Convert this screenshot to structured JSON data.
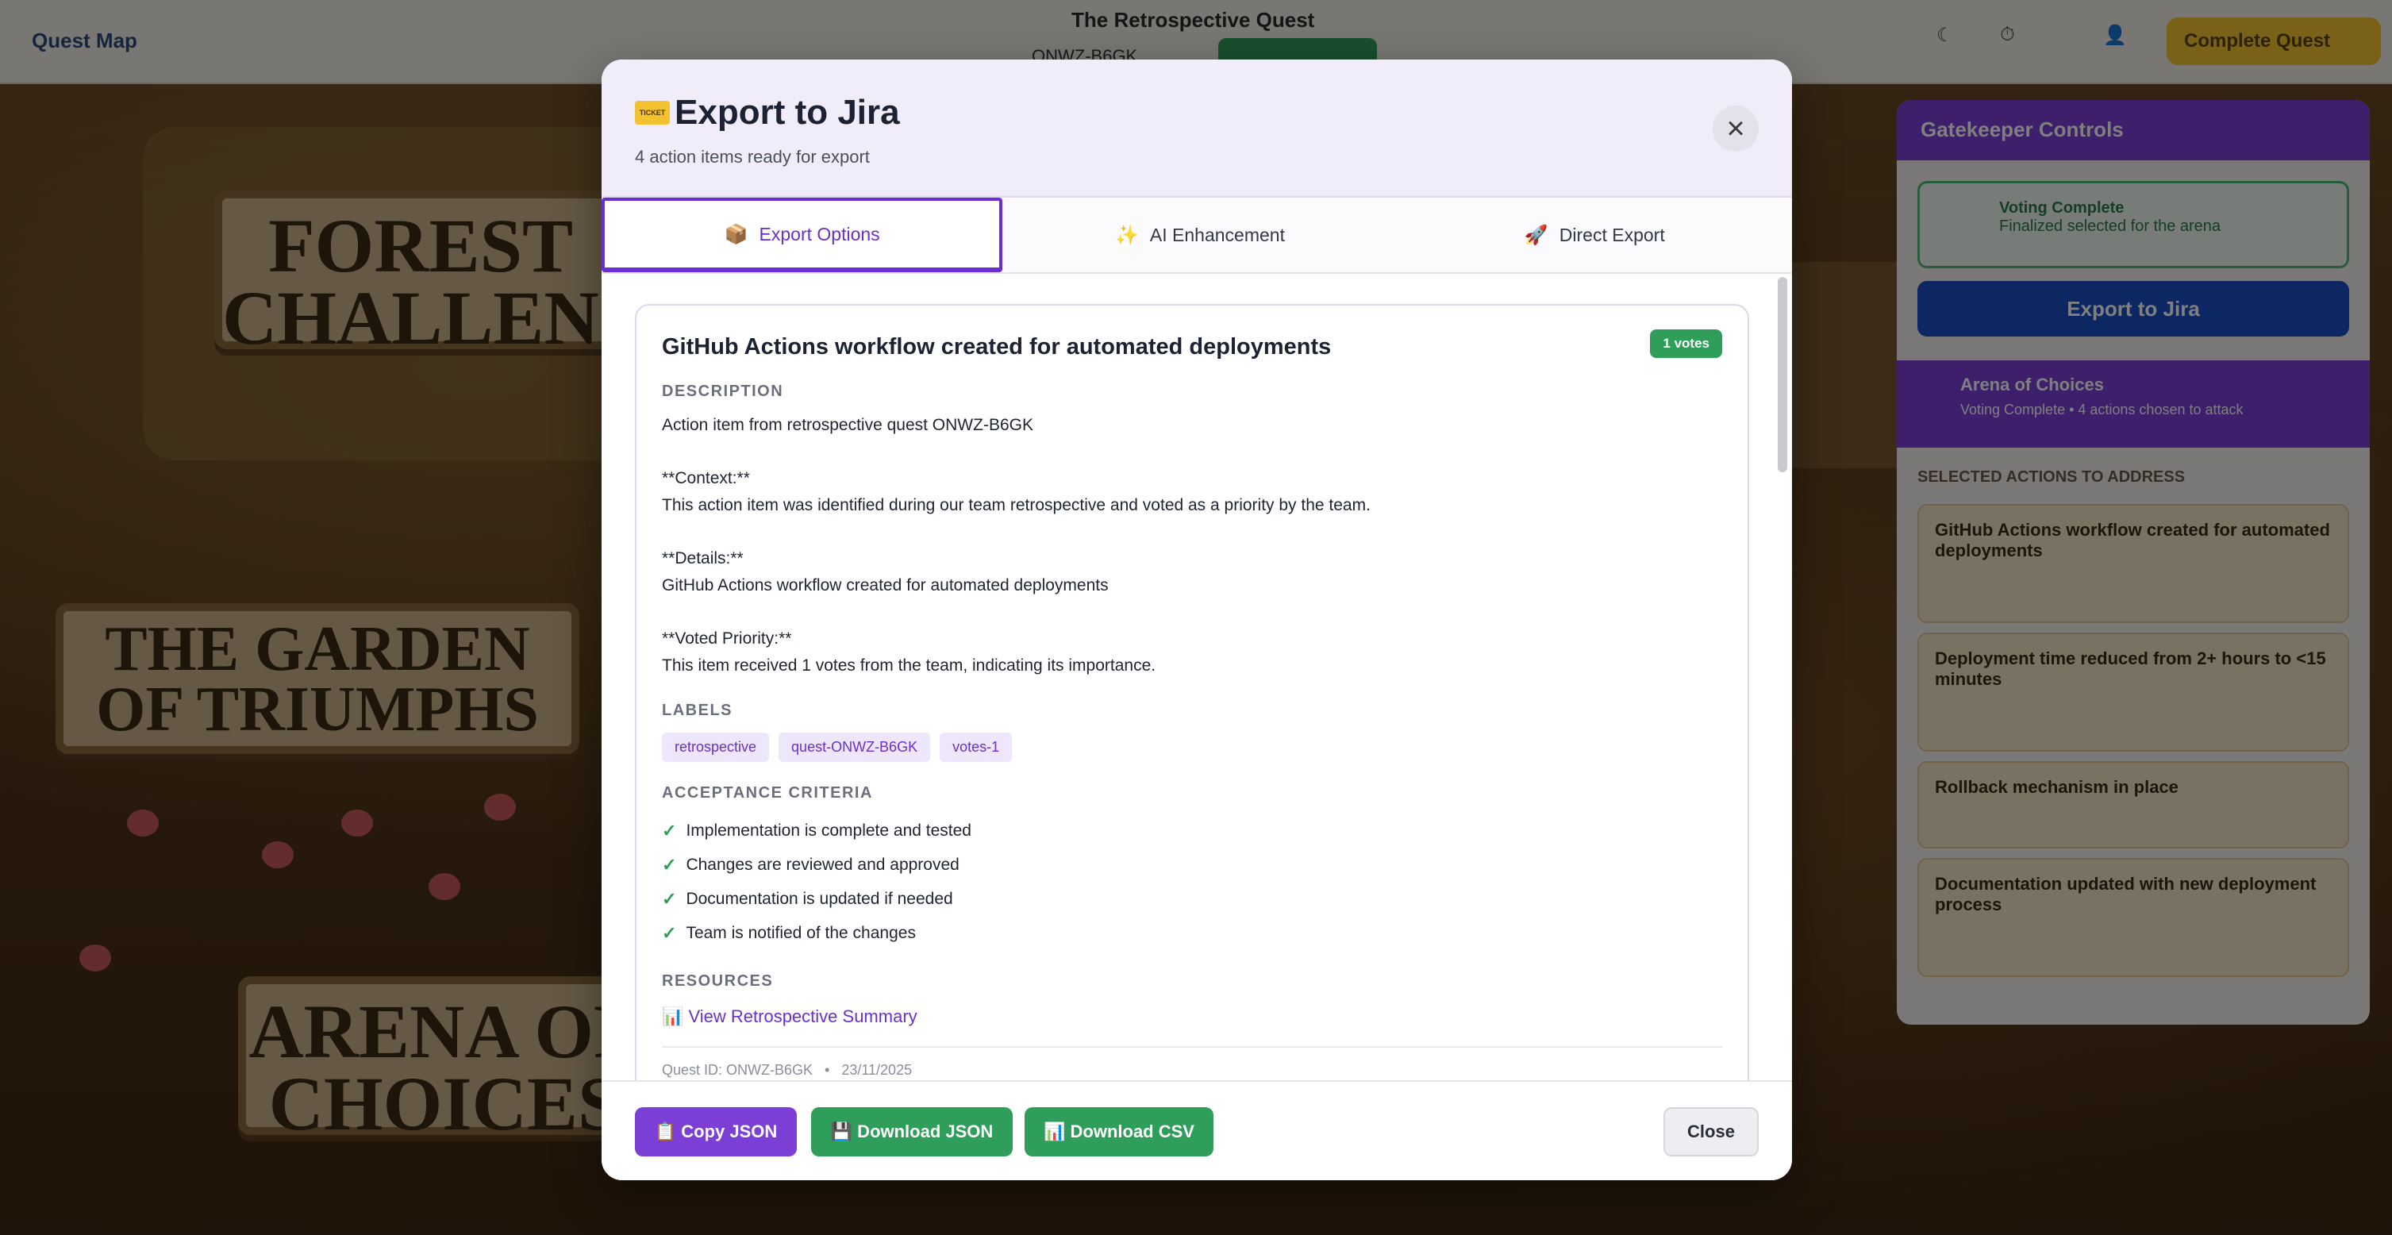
{
  "background": {
    "topbar": {
      "left_label": "Quest Map",
      "title": "The Retrospective Quest",
      "code": "ONWZ-B6GK",
      "complete_button": "Complete Quest"
    },
    "signs": [
      "FOREST CHALLENGES",
      "THE GARDEN OF TRIUMPHS",
      "ARENA OF CHOICES"
    ],
    "side_panel": {
      "header": "Gatekeeper Controls",
      "voting_title": "Voting Complete",
      "voting_sub": "Finalized selected for the arena",
      "export_button": "Export to Jira",
      "arena_title": "Arena of Choices",
      "arena_sub": "Voting Complete • 4 actions chosen to attack",
      "list_heading": "SELECTED ACTIONS TO ADDRESS",
      "items": [
        "GitHub Actions workflow created for automated deployments",
        "Deployment time reduced from 2+ hours to <15 minutes",
        "Rollback mechanism in place",
        "Documentation updated with new deployment process"
      ]
    }
  },
  "modal": {
    "title": "Export to Jira",
    "ticket_icon_text": "TICKET",
    "subtitle": "4 action items ready for export",
    "close_icon": "×",
    "tabs": [
      {
        "icon": "📦",
        "label": "Export Options"
      },
      {
        "icon": "✨",
        "label": "AI Enhancement"
      },
      {
        "icon": "🚀",
        "label": "Direct Export"
      }
    ],
    "card": {
      "title": "GitHub Actions workflow created for automated deployments",
      "votes": "1 votes",
      "description_label": "DESCRIPTION",
      "description": {
        "intro": "Action item from retrospective quest ONWZ-B6GK",
        "context_head": "**Context:**",
        "context_body": "This action item was identified during our team retrospective and voted as a priority by the team.",
        "details_head": "**Details:**",
        "details_body": "GitHub Actions workflow created for automated deployments",
        "priority_head": "**Voted Priority:**",
        "priority_body": "This item received 1 votes from the team, indicating its importance."
      },
      "labels_label": "LABELS",
      "labels": [
        "retrospective",
        "quest-ONWZ-B6GK",
        "votes-1"
      ],
      "criteria_label": "ACCEPTANCE CRITERIA",
      "criteria": [
        "Implementation is complete and tested",
        "Changes are reviewed and approved",
        "Documentation is updated if needed",
        "Team is notified of the changes"
      ],
      "resources_label": "RESOURCES",
      "resource_link": "📊 View Retrospective Summary",
      "meta": "Quest ID: ONWZ-B6GK   •   23/11/2025"
    },
    "footer": {
      "copy_json": "📋 Copy JSON",
      "download_json": "💾 Download JSON",
      "download_csv": "📊 Download CSV",
      "close": "Close"
    }
  }
}
